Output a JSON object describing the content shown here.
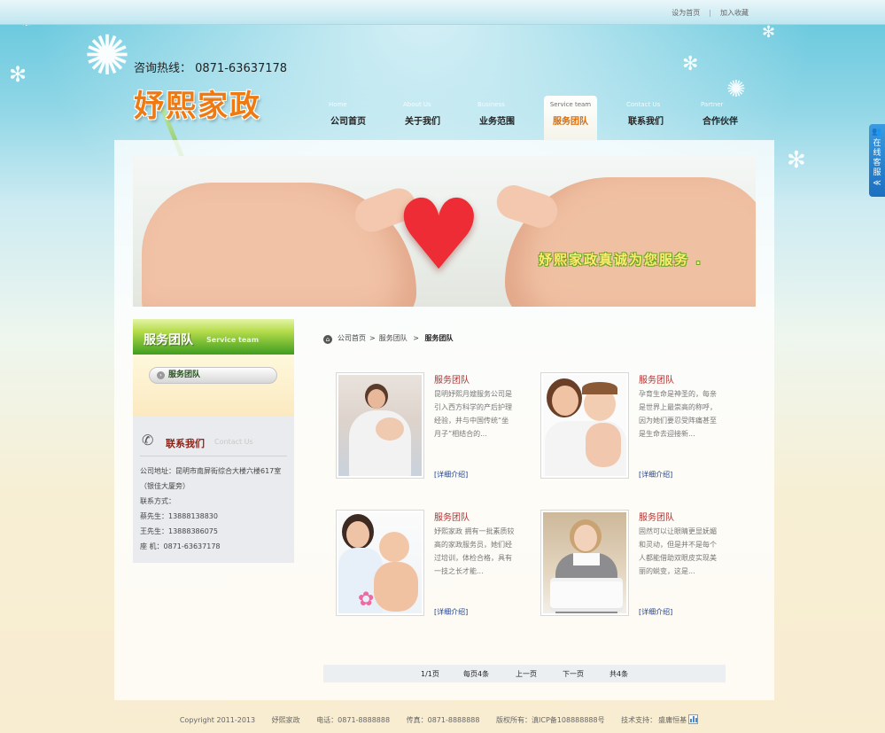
{
  "top_links": {
    "set_home": "设为首页",
    "add_favorite": "加入收藏"
  },
  "header": {
    "hotline": "咨询热线： 0871-63637178",
    "logo_text": "妤熙家政"
  },
  "nav": [
    {
      "en": "Home",
      "cn": "公司首页"
    },
    {
      "en": "About Us",
      "cn": "关于我们"
    },
    {
      "en": "Business",
      "cn": "业务范围"
    },
    {
      "en": "Service team",
      "cn": "服务团队"
    },
    {
      "en": "Contact Us",
      "cn": "联系我们"
    },
    {
      "en": "Partner",
      "cn": "合作伙伴"
    }
  ],
  "banner": {
    "slogan": "妤熙家政真诚为您服务 ."
  },
  "sidebar": {
    "title_cn": "服务团队",
    "title_en": "Service team",
    "menu_item": "服务团队",
    "contact_title_cn": "联系我们",
    "contact_title_en": "Contact Us",
    "contact_lines": [
      "公司地址：昆明市南屏街综合大楼六楼617室",
      "（银佳大厦旁）",
      "联系方式：",
      "蔡先生：13888138830",
      "王先生：13888386075",
      "座 机：0871-63637178"
    ]
  },
  "breadcrumb": {
    "home": "公司首页",
    "level1": "服务团队",
    "current": "服务团队"
  },
  "cards": [
    {
      "title": "服务团队",
      "desc": "昆明妤熙月嫂服务公司是引入西方科学的产后护理经验，并与中国传统“坐月子”相结合的...",
      "more": "[详细介绍]"
    },
    {
      "title": "服务团队",
      "desc": "孕育生命是神圣的，每亲是世界上最崇高的称呼，因为她们要忍受阵痛甚至是生命去迎接新...",
      "more": "[详细介绍]"
    },
    {
      "title": "服务团队",
      "desc": "妤熙家政 拥有一批素质较高的家政服务员，她们经过培训，体检合格，具有一技之长才能...",
      "more": "[详细介绍]"
    },
    {
      "title": "服务团队",
      "desc": "固然可以让眼睛更显妩媚和灵动，但是并不是每个人都能借助双眼皮实现美丽的蜕变，这是...",
      "more": "[详细介绍]"
    }
  ],
  "pager": {
    "page": "1/1页",
    "per_page": "每页4条",
    "prev": "上一页",
    "next": "下一页",
    "total": "共4条"
  },
  "footer": {
    "copyright": "Copyright 2011-2013",
    "company": "妤熙家政",
    "phone": "电话：0871-8888888",
    "fax": "传真：0871-8888888",
    "rights": "版权所有：滇ICP备108888888号",
    "tech": "技术支持：",
    "tech_company": "盛庸恒基"
  },
  "online_service": {
    "label": "在线客服",
    "toggle": "≪"
  }
}
